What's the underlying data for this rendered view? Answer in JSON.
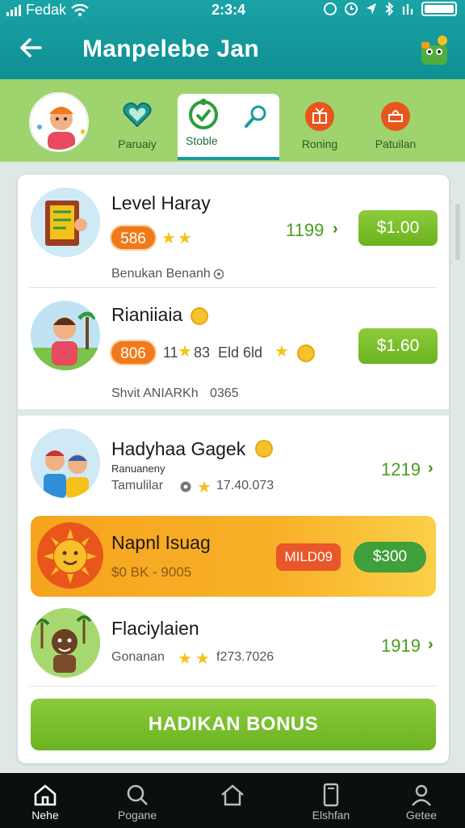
{
  "status_bar": {
    "carrier": "Fedak",
    "time": "2:3:4"
  },
  "header": {
    "title": "Manpelebe Jan"
  },
  "tabs": [
    {
      "label": "Paruaiy"
    },
    {
      "label": "Stoble"
    },
    {
      "label": "Roning"
    },
    {
      "label": "Patuilan"
    }
  ],
  "rows": [
    {
      "name": "Level Haray",
      "badge": "586",
      "points": "1199",
      "price": "$1.00",
      "footer": "Benukan Benanh"
    },
    {
      "name": "Rianiiaia",
      "badge": "806",
      "stat1": "11",
      "stat2": "83",
      "stat3": "Eld 6ld",
      "price": "$1.60",
      "footer": "Shvit ANIARKh",
      "footer_value": "0365"
    },
    {
      "name": "Hadyhaa Gagek",
      "sub": "Ranuaneny",
      "small": "Tamulilar",
      "stat": "17.40.073",
      "points": "1219"
    },
    {
      "name": "Napnl Isuag",
      "sub": "$0 BK - 9005",
      "badge": "MILD09",
      "price": "$300"
    },
    {
      "name": "Flaciylaien",
      "sub": "Gonanan",
      "stat": "f273.7026",
      "points": "1919"
    }
  ],
  "bonus_button": "HADIKAN BONUS",
  "bottom_nav": [
    {
      "label": "Nehe",
      "icon": "home-icon"
    },
    {
      "label": "Pogane",
      "icon": "search-icon"
    },
    {
      "label": "",
      "icon": "house-outline-icon"
    },
    {
      "label": "Elshfan",
      "icon": "phone-icon"
    },
    {
      "label": "Getee",
      "icon": "profile-icon"
    }
  ],
  "colors": {
    "header": "#1aa3a6",
    "tabs_bg": "#9ed36e",
    "accent_green": "#6cb21f",
    "badge_orange": "#f07a1b",
    "highlight_orange": "#f6a41e"
  }
}
